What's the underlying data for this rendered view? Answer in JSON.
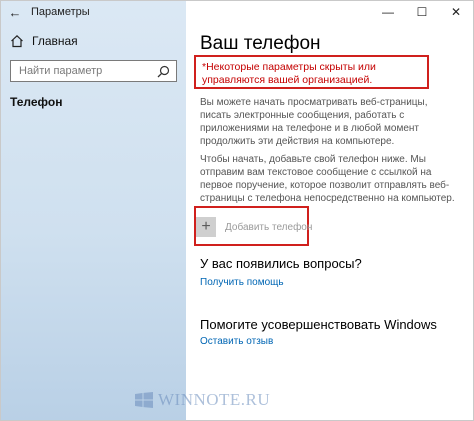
{
  "window": {
    "title": "Параметры",
    "controls": {
      "minimize": "—",
      "maximize": "☐",
      "close": "✕"
    },
    "back_glyph": "←"
  },
  "sidebar": {
    "home_label": "Главная",
    "search_placeholder": "Найти параметр",
    "current_section": "Телефон"
  },
  "main": {
    "title": "Ваш телефон",
    "notice": "*Некоторые параметры скрыты или управляются вашей организацией.",
    "paragraph1": "Вы можете начать просматривать веб-страницы, писать электронные сообщения, работать с приложениями на телефоне и в любой момент продолжить эти действия на компьютере.",
    "paragraph2": "Чтобы начать, добавьте свой телефон ниже. Мы отправим вам текстовое сообщение с ссылкой на первое поручение, которое позволит отправлять веб-страницы с телефона непосредственно на компьютер.",
    "add_phone_label": "Добавить телефон",
    "plus_glyph": "+",
    "questions_heading": "У вас появились вопросы?",
    "help_link": "Получить помощь",
    "improve_heading": "Помогите усовершенствовать Windows",
    "feedback_link": "Оставить отзыв"
  },
  "watermark": {
    "text": "WINNOTE.RU"
  },
  "colors": {
    "highlight_border": "#d0201d",
    "notice_text": "#c40000",
    "link": "#0066b4",
    "sidebar_bg": "#cfe0ef"
  },
  "icons": {
    "back": "back-arrow-icon",
    "home": "home-icon",
    "search": "search-icon",
    "add": "plus-icon",
    "watermark": "windows-logo-icon"
  }
}
